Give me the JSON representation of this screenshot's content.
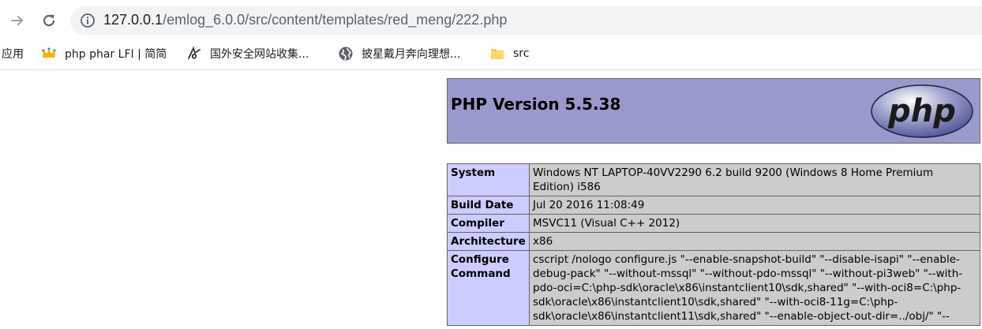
{
  "browser": {
    "url_host": "127.0.0.1",
    "url_path": "/emlog_6.0.0/src/content/templates/red_meng/222.php"
  },
  "bookmarks": [
    {
      "label": "应用",
      "icon": "apps-icon"
    },
    {
      "label": "php phar LFI | 简简",
      "icon": "crown-icon"
    },
    {
      "label": "国外安全网站收集...",
      "icon": "script-logo-icon"
    },
    {
      "label": "披星戴月奔向理想...",
      "icon": "globe-icon"
    },
    {
      "label": "src",
      "icon": "folder-icon"
    }
  ],
  "phpinfo": {
    "title": "PHP Version 5.5.38",
    "logo_text": "php",
    "rows": [
      {
        "key": "System",
        "value": "Windows NT LAPTOP-40VV2290 6.2 build 9200 (Windows 8 Home Premium Edition) i586"
      },
      {
        "key": "Build Date",
        "value": "Jul 20 2016 11:08:49"
      },
      {
        "key": "Compiler",
        "value": "MSVC11 (Visual C++ 2012)"
      },
      {
        "key": "Architecture",
        "value": "x86"
      },
      {
        "key": "Configure Command",
        "value": "cscript /nologo configure.js \"--enable-snapshot-build\" \"--disable-isapi\" \"--enable-debug-pack\" \"--without-mssql\" \"--without-pdo-mssql\" \"--without-pi3web\" \"--with-pdo-oci=C:\\php-sdk\\oracle\\x86\\instantclient10\\sdk,shared\" \"--with-oci8=C:\\php-sdk\\oracle\\x86\\instantclient10\\sdk,shared\" \"--with-oci8-11g=C:\\php-sdk\\oracle\\x86\\instantclient11\\sdk,shared\" \"--enable-object-out-dir=../obj/\" \"--"
      }
    ]
  },
  "colors": {
    "header_bg": "#9999cc",
    "key_bg": "#ccccff",
    "value_bg": "#cccccc",
    "border": "#666666"
  }
}
